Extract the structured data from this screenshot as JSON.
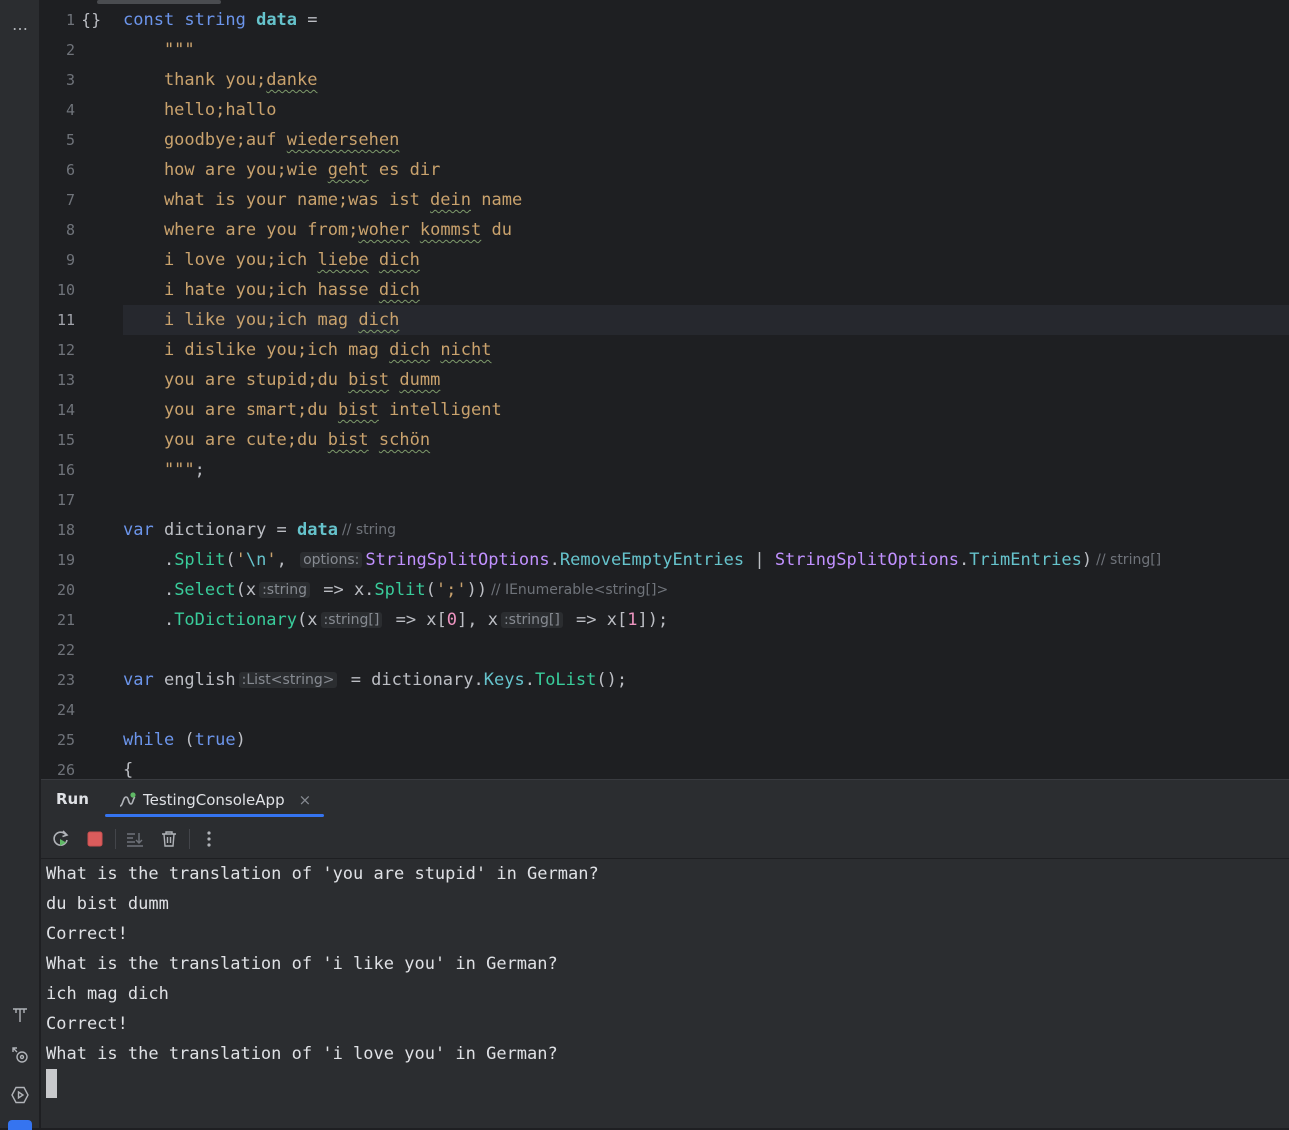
{
  "sidebar": {
    "more_label": "…",
    "icons": [
      "build-icon",
      "services-icon",
      "run-configurations-icon"
    ]
  },
  "editor": {
    "line_numbers": [
      "1",
      "2",
      "3",
      "4",
      "5",
      "6",
      "7",
      "8",
      "9",
      "10",
      "11",
      "12",
      "13",
      "14",
      "15",
      "16",
      "17",
      "18",
      "19",
      "20",
      "21",
      "22",
      "23",
      "24",
      "25",
      "26"
    ],
    "line1_marker": "{}",
    "current_line": 11,
    "lines": [
      {
        "parts": [
          [
            "kw",
            "const "
          ],
          [
            "kw",
            "string "
          ],
          [
            "ident-bold",
            "data"
          ],
          [
            "",
            " ="
          ]
        ]
      },
      {
        "parts": [
          [
            "str",
            "    \"\"\""
          ]
        ]
      },
      {
        "parts": [
          [
            "str",
            "    thank you;"
          ],
          [
            "str squig",
            "danke"
          ]
        ]
      },
      {
        "parts": [
          [
            "str",
            "    hello;hallo"
          ]
        ]
      },
      {
        "parts": [
          [
            "str",
            "    goodbye;auf "
          ],
          [
            "str squig",
            "wiedersehen"
          ]
        ]
      },
      {
        "parts": [
          [
            "str",
            "    how are you;wie "
          ],
          [
            "str squig",
            "geht"
          ],
          [
            "str",
            " es dir"
          ]
        ]
      },
      {
        "parts": [
          [
            "str",
            "    what is your name;was ist "
          ],
          [
            "str squig",
            "dein"
          ],
          [
            "str",
            " name"
          ]
        ]
      },
      {
        "parts": [
          [
            "str",
            "    where are you from;"
          ],
          [
            "str squig",
            "woher"
          ],
          [
            "str",
            " "
          ],
          [
            "str squig",
            "kommst"
          ],
          [
            "str",
            " du"
          ]
        ]
      },
      {
        "parts": [
          [
            "str",
            "    i love you;ich "
          ],
          [
            "str squig",
            "liebe"
          ],
          [
            "str",
            " "
          ],
          [
            "str squig",
            "dich"
          ]
        ]
      },
      {
        "parts": [
          [
            "str",
            "    i hate you;ich hasse "
          ],
          [
            "str squig",
            "dich"
          ]
        ]
      },
      {
        "parts": [
          [
            "str",
            "    i like you;ich mag "
          ],
          [
            "str squig",
            "dich"
          ]
        ]
      },
      {
        "parts": [
          [
            "str",
            "    i dislike you;ich mag "
          ],
          [
            "str squig",
            "dich"
          ],
          [
            "str",
            " "
          ],
          [
            "str squig",
            "nicht"
          ]
        ]
      },
      {
        "parts": [
          [
            "str",
            "    you are stupid;du "
          ],
          [
            "str squig",
            "bist"
          ],
          [
            "str",
            " "
          ],
          [
            "str squig",
            "dumm"
          ]
        ]
      },
      {
        "parts": [
          [
            "str",
            "    you are smart;du "
          ],
          [
            "str squig",
            "bist"
          ],
          [
            "str",
            " intelligent"
          ]
        ]
      },
      {
        "parts": [
          [
            "str",
            "    you are cute;du "
          ],
          [
            "str squig",
            "bist"
          ],
          [
            "str",
            " "
          ],
          [
            "str squig",
            "schön"
          ]
        ]
      },
      {
        "parts": [
          [
            "str",
            "    \"\"\""
          ],
          [
            "",
            ";"
          ]
        ]
      },
      {
        "parts": []
      },
      {
        "parts": [
          [
            "kw",
            "var "
          ],
          [
            "",
            "dictionary = "
          ],
          [
            "ident-bold",
            "data"
          ],
          [
            "hint-plain",
            "// string"
          ]
        ]
      },
      {
        "parts": [
          [
            "",
            "    ."
          ],
          [
            "method",
            "Split"
          ],
          [
            "",
            "("
          ],
          [
            "str",
            "'"
          ],
          [
            "prop",
            "\\n"
          ],
          [
            "str",
            "'"
          ],
          [
            "",
            ", "
          ],
          [
            "hint",
            "options:"
          ],
          [
            "type",
            "StringSplitOptions"
          ],
          [
            "",
            "."
          ],
          [
            "enumv",
            "RemoveEmptyEntries"
          ],
          [
            "",
            " | "
          ],
          [
            "type",
            "StringSplitOptions"
          ],
          [
            "",
            "."
          ],
          [
            "enumv",
            "TrimEntries"
          ],
          [
            "",
            ")"
          ],
          [
            "hint-plain",
            "// string[]"
          ]
        ]
      },
      {
        "parts": [
          [
            "",
            "    ."
          ],
          [
            "method",
            "Select"
          ],
          [
            "",
            "(x"
          ],
          [
            "hint",
            ":string"
          ],
          [
            "",
            " => x."
          ],
          [
            "method",
            "Split"
          ],
          [
            "",
            "("
          ],
          [
            "str",
            "';'"
          ],
          [
            "",
            "))"
          ],
          [
            "hint-plain",
            "// IEnumerable<string[]>"
          ]
        ]
      },
      {
        "parts": [
          [
            "",
            "    ."
          ],
          [
            "method",
            "ToDictionary"
          ],
          [
            "",
            "(x"
          ],
          [
            "hint",
            ":string[]"
          ],
          [
            "",
            " => x["
          ],
          [
            "num",
            "0"
          ],
          [
            "",
            "], x"
          ],
          [
            "hint",
            ":string[]"
          ],
          [
            "",
            " => x["
          ],
          [
            "num",
            "1"
          ],
          [
            "",
            "]);"
          ]
        ]
      },
      {
        "parts": []
      },
      {
        "parts": [
          [
            "kw",
            "var "
          ],
          [
            "",
            "english"
          ],
          [
            "hint",
            ":List<string>"
          ],
          [
            "",
            " = dictionary."
          ],
          [
            "prop",
            "Keys"
          ],
          [
            "",
            "."
          ],
          [
            "method",
            "ToList"
          ],
          [
            "",
            "();"
          ]
        ]
      },
      {
        "parts": []
      },
      {
        "parts": [
          [
            "kw",
            "while "
          ],
          [
            "",
            "("
          ],
          [
            "kw",
            "true"
          ],
          [
            "",
            ")"
          ]
        ]
      },
      {
        "parts": [
          [
            "",
            "{"
          ]
        ]
      }
    ]
  },
  "tool_window": {
    "title": "Run",
    "tab_label": "TestingConsoleApp",
    "tab_close": "×"
  },
  "console": {
    "lines": [
      "What is the translation of 'you are stupid' in German?",
      "du bist dumm",
      "Correct!",
      "What is the translation of 'i like you' in German?",
      "ich mag dich",
      "Correct!",
      "What is the translation of 'i love you' in German?"
    ]
  },
  "colors": {
    "accent": "#3574f0",
    "keyword": "#6c95eb",
    "string": "#c9a26d",
    "method": "#39cc9b",
    "stop": "#c94f4f"
  }
}
